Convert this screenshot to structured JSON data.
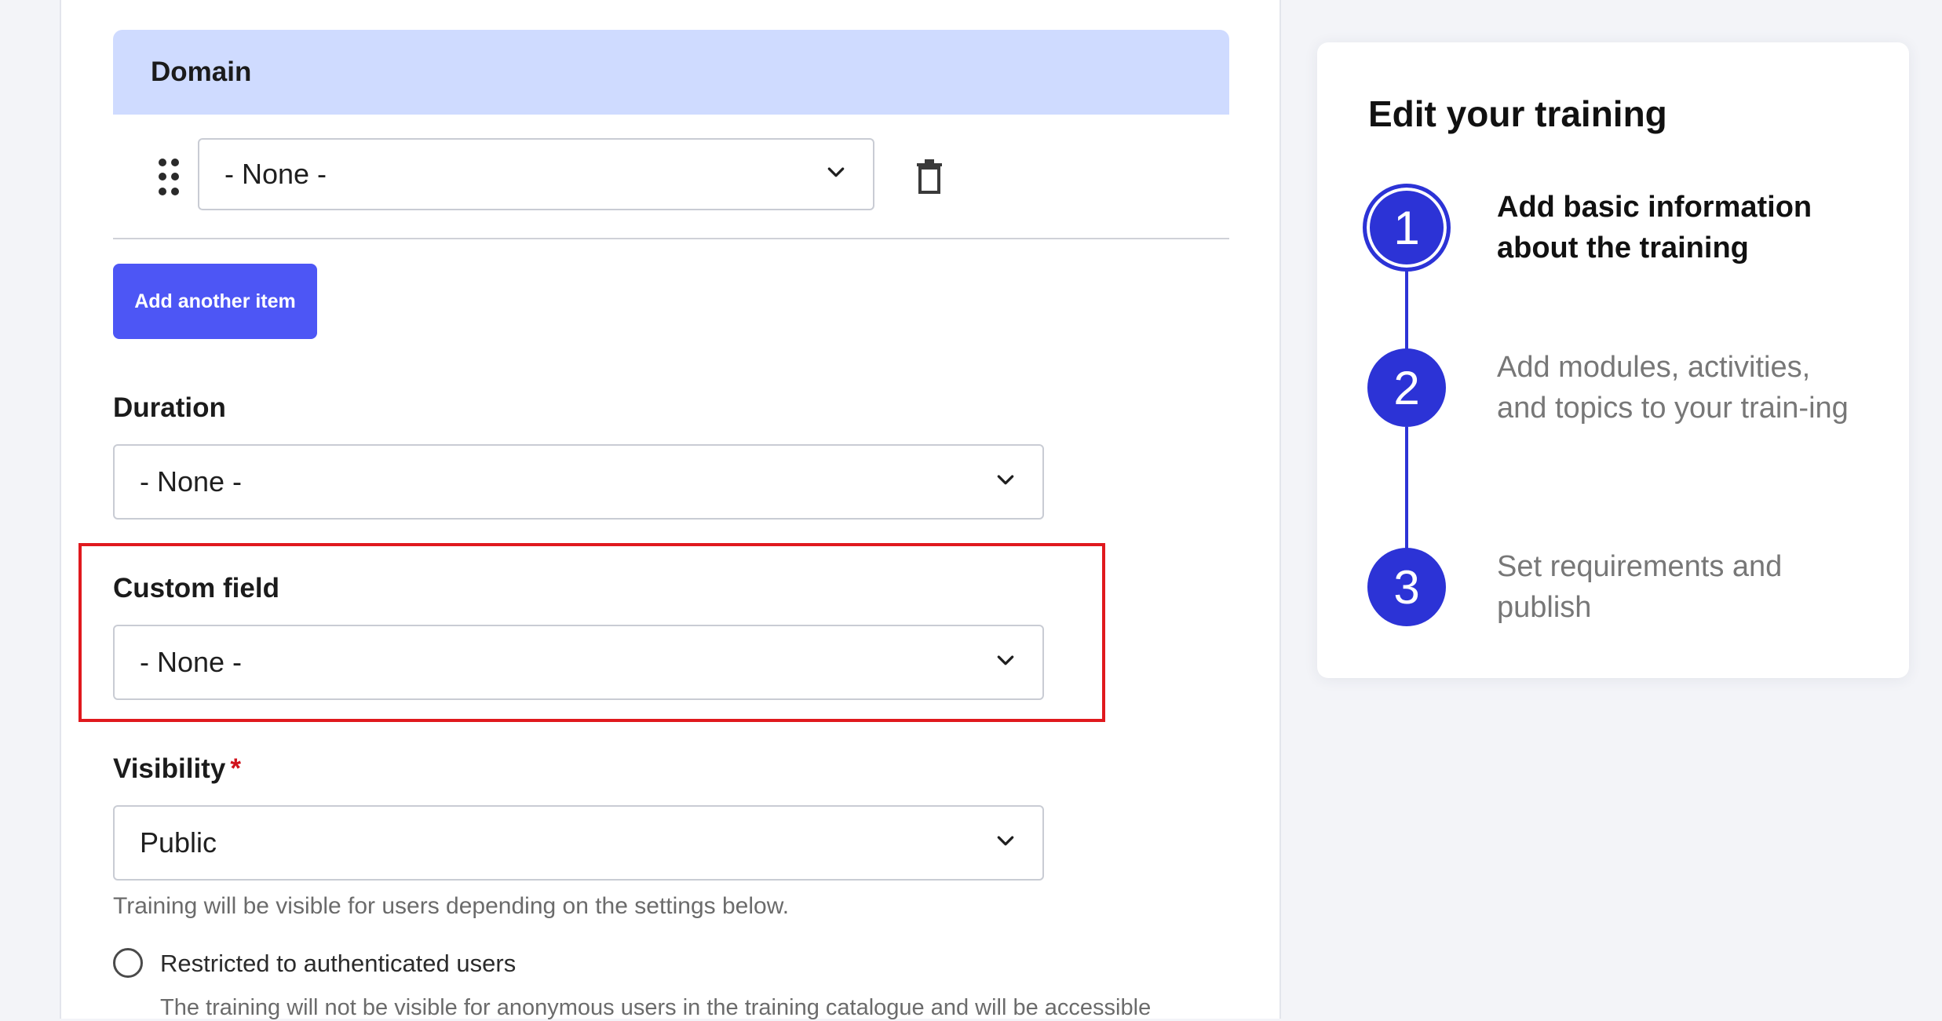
{
  "form": {
    "domain": {
      "header": "Domain",
      "select_value": "- None -",
      "add_button": "Add another item"
    },
    "duration": {
      "label": "Duration",
      "value": "- None -"
    },
    "custom_field": {
      "label": "Custom field",
      "value": "- None -"
    },
    "visibility": {
      "label": "Visibility",
      "required_mark": "*",
      "value": "Public",
      "help": "Training will be visible for users depending on the settings below.",
      "options": [
        {
          "label": "Restricted to authenticated users",
          "description": "The training will not be visible for anonymous users in the training catalogue and will be accessible"
        }
      ]
    }
  },
  "sidebar": {
    "title": "Edit your training",
    "steps": [
      {
        "number": "1",
        "label": "Add basic information about the training",
        "active": true
      },
      {
        "number": "2",
        "label": "Add modules, activities, and topics to your train-ing",
        "active": false
      },
      {
        "number": "3",
        "label": "Set requirements and publish",
        "active": false
      }
    ]
  },
  "colors": {
    "accent": "#4d56f5",
    "step_blue": "#2c33d6",
    "domain_header_bg": "#cfdbff",
    "highlight": "#e0191e",
    "required": "#d0121b"
  }
}
